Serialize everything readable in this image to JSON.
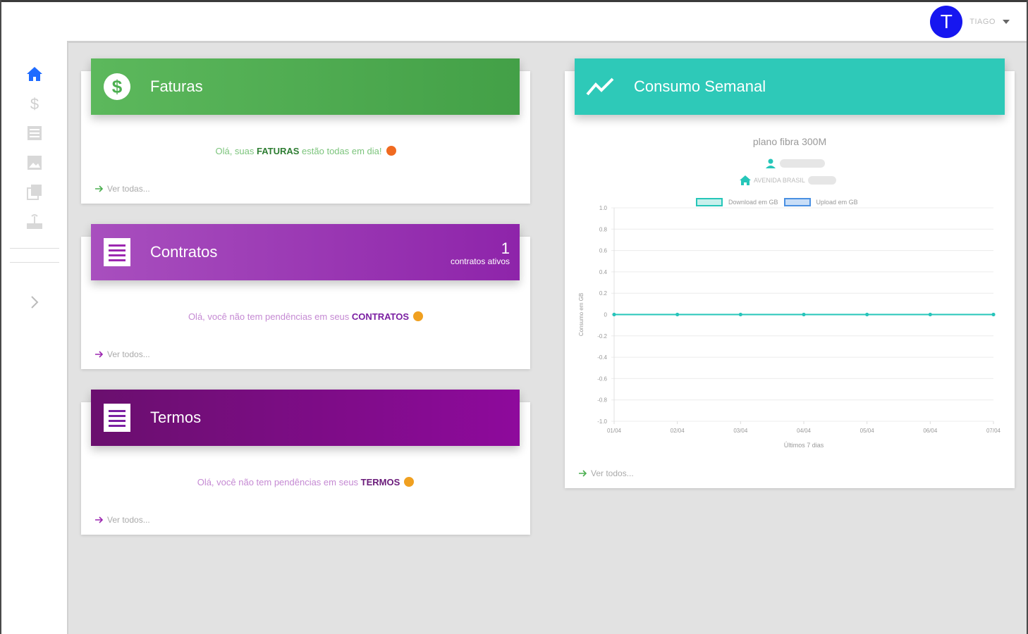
{
  "header": {
    "user_initial": "T",
    "user_name": "TIAGO"
  },
  "sidebar": {
    "items": [
      {
        "icon": "home-icon",
        "active": true
      },
      {
        "icon": "dollar-icon",
        "active": false
      },
      {
        "icon": "list-icon",
        "active": false
      },
      {
        "icon": "image-icon",
        "active": false
      },
      {
        "icon": "copy-icon",
        "active": false
      },
      {
        "icon": "router-icon",
        "active": false
      }
    ],
    "expand_icon": "chevron-right-icon"
  },
  "cards": {
    "faturas": {
      "title": "Faturas",
      "msg_before": "Olá, suas ",
      "msg_bold": "FATURAS",
      "msg_after": " estão todas em dia!",
      "link": "Ver todas..."
    },
    "contratos": {
      "title": "Contratos",
      "count": "1",
      "count_label": "contratos ativos",
      "msg_before": "Olá, você não tem pendências em seus ",
      "msg_bold": "CONTRATOS",
      "link": "Ver todos..."
    },
    "termos": {
      "title": "Termos",
      "msg_before": "Olá, você não tem pendências em seus ",
      "msg_bold": "TERMOS",
      "link": "Ver todos..."
    },
    "consumo": {
      "title": "Consumo Semanal",
      "plan": "plano fibra 300M",
      "address": "AVENIDA BRASIL",
      "link": "Ver todos..."
    }
  },
  "colors": {
    "faturas": "#4caf50",
    "contratos": "#9c27b0",
    "termos": "#7b1fa2",
    "consumo": "#26c6b9",
    "avatar": "#1616f0",
    "active_icon": "#1e6bff"
  },
  "chart_data": {
    "type": "line",
    "categories": [
      "01/04",
      "02/04",
      "03/04",
      "04/04",
      "05/04",
      "06/04",
      "07/04"
    ],
    "series": [
      {
        "name": "Download em GB",
        "values": [
          0,
          0,
          0,
          0,
          0,
          0,
          0
        ],
        "color": "#26c6b9"
      },
      {
        "name": "Upload em GB",
        "values": [
          0,
          0,
          0,
          0,
          0,
          0,
          0
        ],
        "color": "#4a90e2"
      }
    ],
    "xlabel": "Últimos 7 dias",
    "ylabel": "Consumo em GB",
    "ylim": [
      -1.0,
      1.0
    ],
    "yticks": [
      "1.0",
      "0.8",
      "0.6",
      "0.4",
      "0.2",
      "0",
      "-0.2",
      "-0.4",
      "-0.6",
      "-0.8",
      "-1.0"
    ],
    "grid": true,
    "legend_position": "top-center"
  }
}
